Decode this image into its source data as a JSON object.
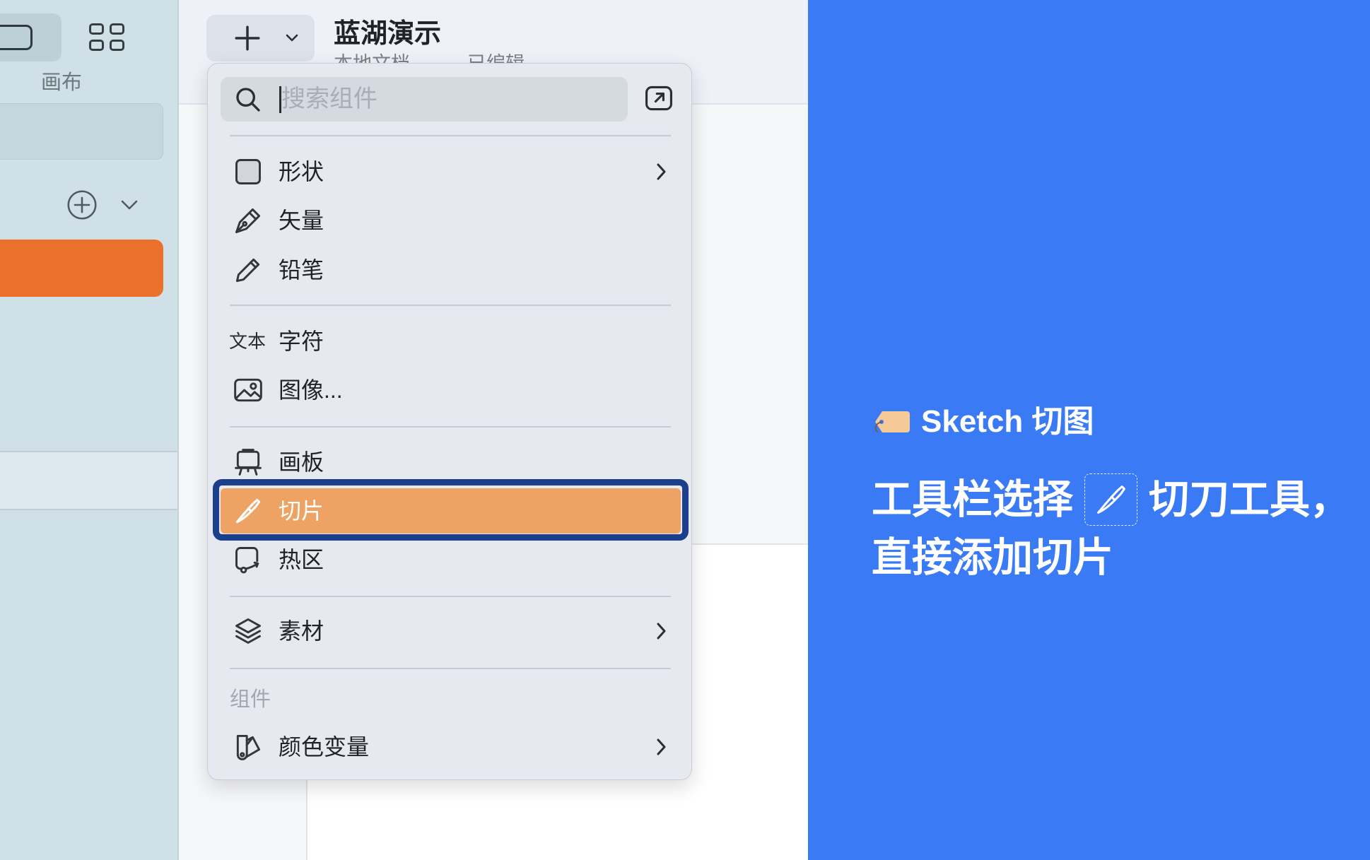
{
  "window": {
    "title": "蓝湖演示",
    "subtitle_location": "本地文档",
    "subtitle_status": "已编辑"
  },
  "sidebar": {
    "view_toggle_label": "画布",
    "view_toggle_icons": [
      "canvas-view-icon",
      "grid-view-icon"
    ],
    "add_page_icon": "circle-plus-icon",
    "collapse_icon": "chevron-down-icon"
  },
  "toolbar": {
    "insert_button_icons": [
      "plus-icon",
      "chevron-down-icon"
    ]
  },
  "insert_menu": {
    "search": {
      "placeholder": "搜索组件",
      "icon": "search-icon"
    },
    "popout_icon": "external-window-icon",
    "items": [
      {
        "label": "形状",
        "icon": "square-icon",
        "submenu": true
      },
      {
        "label": "矢量",
        "icon": "pen-icon",
        "submenu": false
      },
      {
        "label": "铅笔",
        "icon": "pencil-icon",
        "submenu": false
      },
      {
        "label": "字符",
        "icon": "text-icon",
        "icon_text": "文本",
        "submenu": false
      },
      {
        "label": "图像...",
        "icon": "image-icon",
        "submenu": false
      },
      {
        "label": "画板",
        "icon": "artboard-icon",
        "submenu": false
      },
      {
        "label": "切片",
        "icon": "slice-knife-icon",
        "submenu": false,
        "highlighted": true
      },
      {
        "label": "热区",
        "icon": "hotspot-icon",
        "submenu": false
      },
      {
        "label": "素材",
        "icon": "layers-icon",
        "submenu": true
      }
    ],
    "components_section": {
      "header": "组件",
      "items": [
        {
          "label": "颜色变量",
          "icon": "color-swatch-icon",
          "submenu": true
        }
      ]
    }
  },
  "callout": {
    "title_icon": "label-tag-icon",
    "title": "Sketch 切图",
    "line1_before": "工具栏选择",
    "inline_icon": "slice-knife-icon",
    "line1_after": "切刀工具，",
    "line2": "直接添加切片"
  },
  "colors": {
    "sidebar_bg": "#cfe1e7",
    "selected_page": "#e9712c",
    "menu_bg": "#e6e9ef",
    "menu_highlight": "#eea365",
    "highlight_outline": "#1c3f8c",
    "callout_bg": "#3a7bf5",
    "callout_text": "#ffffff"
  }
}
